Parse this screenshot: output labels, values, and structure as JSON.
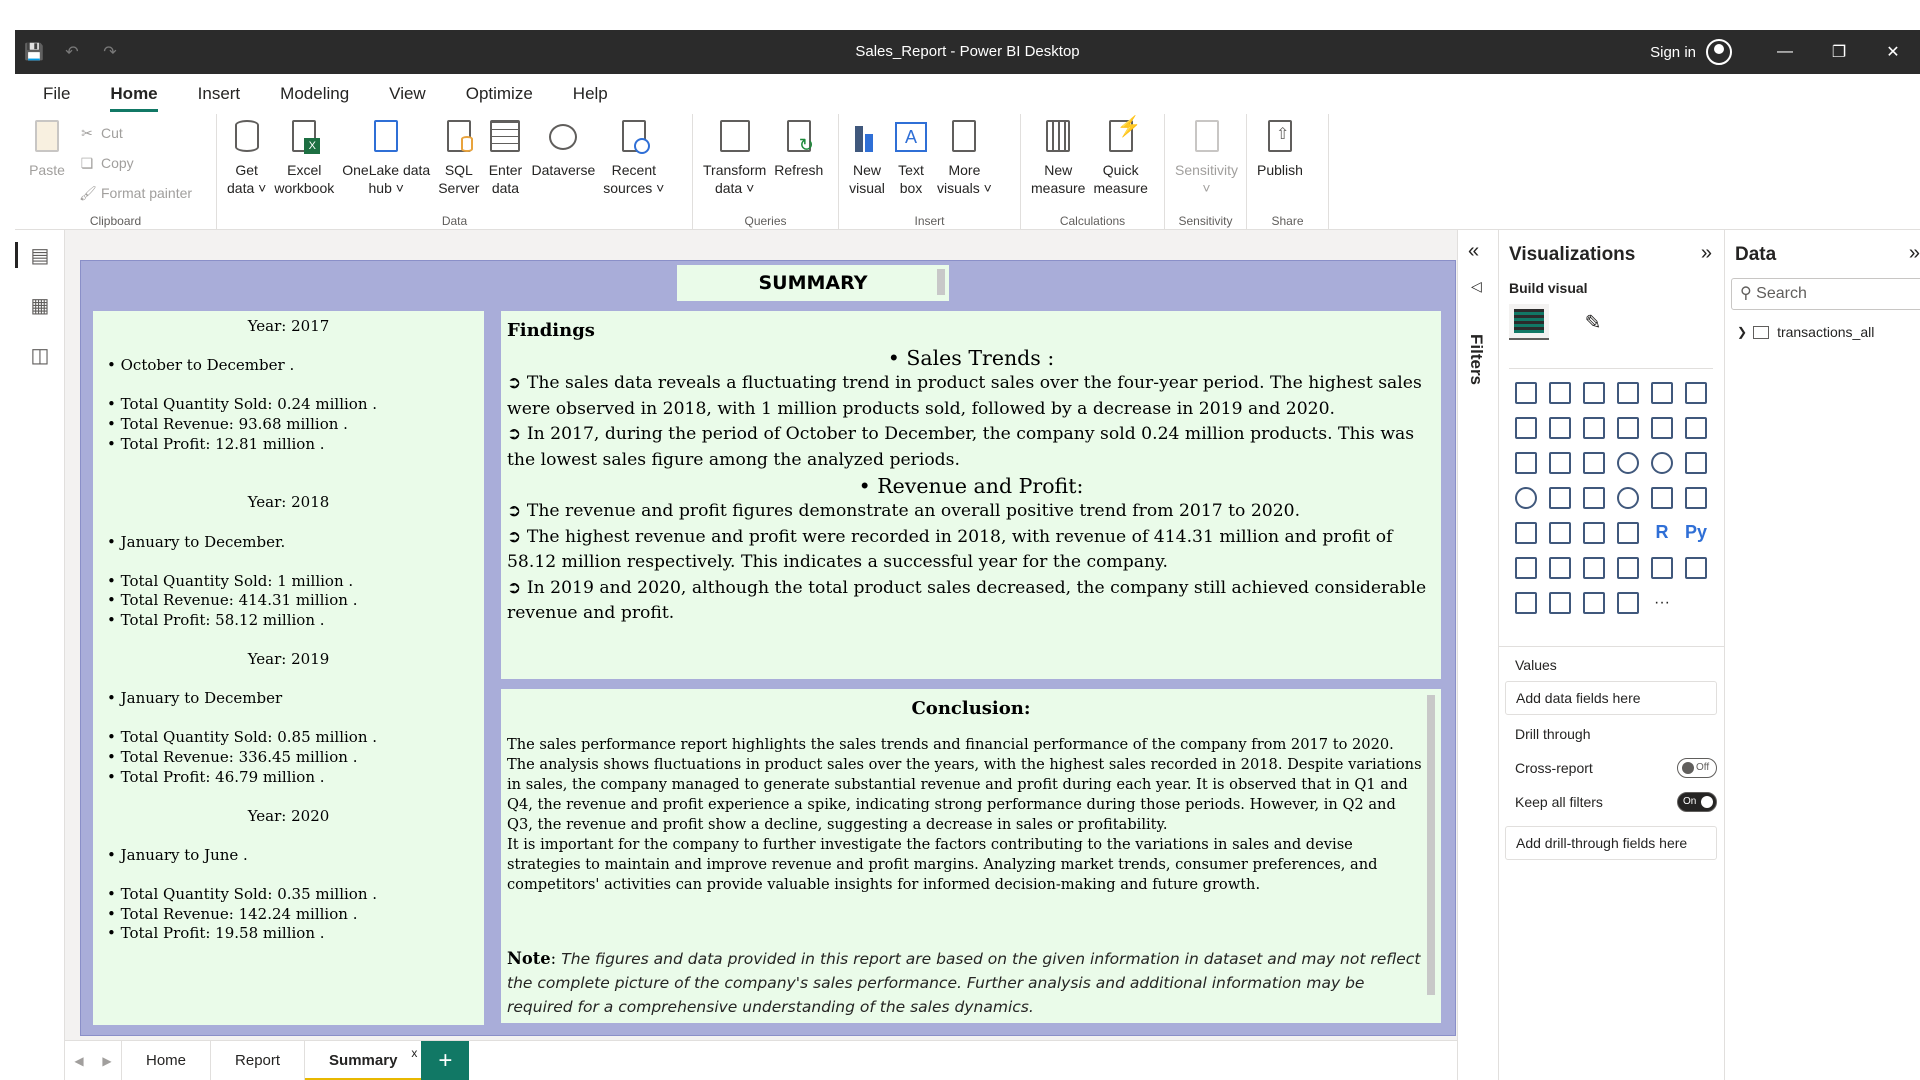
{
  "window": {
    "title": "Sales_Report - Power BI Desktop",
    "sign_in": "Sign in"
  },
  "menu": [
    "File",
    "Home",
    "Insert",
    "Modeling",
    "View",
    "Optimize",
    "Help"
  ],
  "ribbon": {
    "clipboard": {
      "label": "Clipboard",
      "paste": "Paste",
      "cut": "Cut",
      "copy": "Copy",
      "format_painter": "Format painter"
    },
    "data": {
      "label": "Data",
      "get_data": [
        "Get",
        "data"
      ],
      "excel": [
        "Excel",
        "workbook"
      ],
      "onelake": [
        "OneLake data",
        "hub"
      ],
      "sql": [
        "SQL",
        "Server"
      ],
      "enter": [
        "Enter",
        "data"
      ],
      "dataverse": "Dataverse",
      "recent": [
        "Recent",
        "sources"
      ]
    },
    "queries": {
      "label": "Queries",
      "transform": [
        "Transform",
        "data"
      ],
      "refresh": "Refresh"
    },
    "insert": {
      "label": "Insert",
      "new_visual": [
        "New",
        "visual"
      ],
      "text_box": [
        "Text",
        "box"
      ],
      "more_visuals": [
        "More",
        "visuals"
      ]
    },
    "calculations": {
      "label": "Calculations",
      "new_measure": [
        "New",
        "measure"
      ],
      "quick_measure": [
        "Quick",
        "measure"
      ]
    },
    "sensitivity": {
      "label": "Sensitivity",
      "button": "Sensitivity"
    },
    "share": {
      "label": "Share",
      "publish": "Publish"
    }
  },
  "report": {
    "title": "SUMMARY",
    "years": [
      {
        "year": "Year: 2017",
        "period": "• October to December .",
        "qty": "• Total Quantity Sold: 0.24 million .",
        "revenue": "• Total Revenue: 93.68 million .",
        "profit": "• Total Profit: 12.81 million ."
      },
      {
        "year": "Year: 2018",
        "period": "• January to December.",
        "qty": "• Total Quantity Sold: 1 million .",
        "revenue": "• Total Revenue: 414.31 million .",
        "profit": "• Total Profit: 58.12 million ."
      },
      {
        "year": "Year: 2019",
        "period": "• January to December",
        "qty": "• Total Quantity Sold: 0.85 million .",
        "revenue": "• Total Revenue: 336.45 million .",
        "profit": "• Total Profit: 46.79 million ."
      },
      {
        "year": "Year: 2020",
        "period": "• January to June .",
        "qty": "• Total Quantity Sold: 0.35 million .",
        "revenue": "• Total Revenue: 142.24 million .",
        "profit": "• Total Profit: 19.58 million ."
      }
    ],
    "findings": {
      "heading": "Findings",
      "sales_trends": "• Sales Trends :",
      "st1": "➲ The sales data reveals a fluctuating trend in product sales over the four-year period. The highest sales were observed in 2018, with 1 million products sold, followed by a decrease in 2019 and 2020.",
      "st2": "➲ In 2017, during the period of October to December, the company sold 0.24 million products. This was the lowest sales figure among the analyzed periods.",
      "rev_profit": "• Revenue and Profit:",
      "rp1": "➲ The revenue and profit figures demonstrate an overall positive trend from 2017 to 2020.",
      "rp2": "➲ The highest revenue and profit were recorded in 2018, with revenue of 414.31 million and profit of 58.12 million respectively. This indicates a successful year for the company.",
      "rp3": "➲ In 2019 and 2020, although the total product sales decreased, the company still achieved considerable revenue and profit."
    },
    "conclusion": {
      "heading": "Conclusion:",
      "p1": "The sales performance report highlights the sales trends and financial performance of the company from 2017 to 2020. The analysis shows fluctuations in product sales over the years, with the highest sales recorded in 2018. Despite variations in sales, the company managed to generate substantial revenue and profit during each year. It is observed that in Q1 and Q4, the revenue and profit experience a spike, indicating strong performance during those periods. However, in Q2 and Q3, the revenue and profit show a decline, suggesting a decrease in sales or profitability.",
      "p2": "It is important for the company to further investigate the factors contributing to the variations in sales and devise strategies to maintain and improve revenue and profit margins. Analyzing market trends, consumer preferences, and competitors' activities can provide valuable insights for informed decision-making and future growth.",
      "note_label": "Note",
      "note_text": "The figures and data provided in this report are based on the given information in dataset and may not reflect the complete picture of the company's sales performance. Further analysis and additional information may be required for a comprehensive understanding of the sales dynamics."
    }
  },
  "page_tabs": [
    "Home",
    "Report",
    "Summary"
  ],
  "filters": {
    "label": "Filters"
  },
  "visualizations": {
    "title": "Visualizations",
    "build_visual": "Build visual",
    "values": "Values",
    "add_data_fields": "Add data fields here",
    "drill_through": "Drill through",
    "cross_report": "Cross-report",
    "cross_report_state": "Off",
    "keep_all_filters": "Keep all filters",
    "keep_all_filters_state": "On",
    "add_drill_fields": "Add drill-through fields here",
    "r_label": "R",
    "py_label": "Py",
    "more": "···"
  },
  "data_pane": {
    "title": "Data",
    "search_placeholder": "Search",
    "table": "transactions_all"
  },
  "colors": {
    "accent": "#117865",
    "page_bg": "#a9add9",
    "panel_bg": "#eafbe9",
    "titlebar": "#2b2b2b"
  }
}
